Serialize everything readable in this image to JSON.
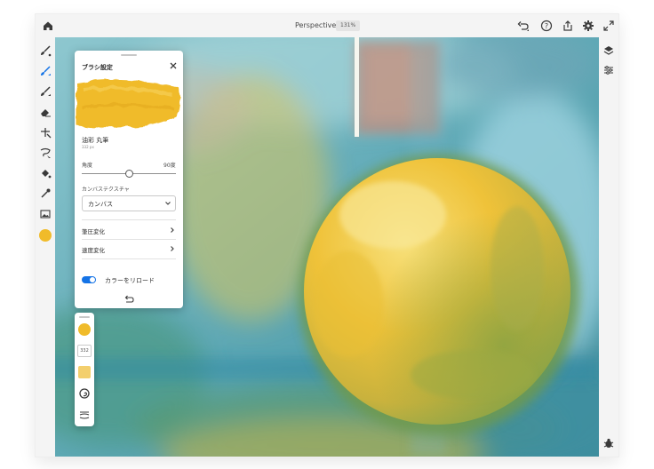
{
  "app": {
    "document_title": "Perspective",
    "zoom_level": "131%"
  },
  "toolbar_top": {
    "icons": [
      "home-icon",
      "undo-icon",
      "help-icon",
      "share-icon",
      "settings-icon",
      "fullscreen-icon"
    ]
  },
  "toolbar_left": {
    "icons": [
      "paint-brush-icon",
      "pixel-brush-icon",
      "mixer-brush-icon",
      "eraser-icon",
      "transform-icon",
      "selection-icon",
      "fill-icon",
      "eyedropper-icon",
      "image-icon"
    ],
    "active_color": "#F0BB2A"
  },
  "toolbar_right": {
    "icons": [
      "layers-icon",
      "adjustments-icon",
      "bug-report-icon"
    ]
  },
  "brush_settings": {
    "title": "ブラシ設定",
    "brush_name": "油彩 丸筆",
    "brush_size_text": "332 px",
    "stroke_color": "#F0BB2A",
    "angle_label": "角度",
    "angle_value": "90度",
    "angle_fraction": 0.5,
    "canvas_texture_label": "カンバステクスチャ",
    "canvas_texture_value": "カンバス",
    "pressure_label": "筆圧変化",
    "speed_label": "速度変化",
    "reload_color_label": "カラーをリロード",
    "reload_color_on": true
  },
  "mini_palette": {
    "size_value": "332",
    "color": "#F0BB2A",
    "opacity_color": "#F3CF6D"
  }
}
